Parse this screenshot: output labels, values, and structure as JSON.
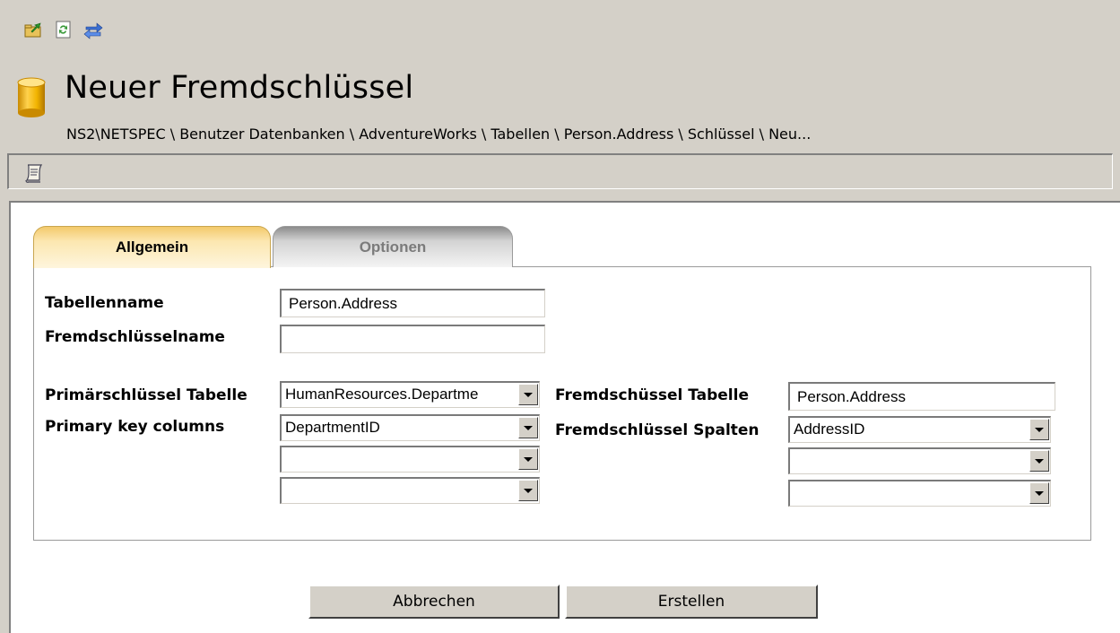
{
  "toolbar": {
    "icons": [
      "export-icon",
      "refresh-icon",
      "sync-icon"
    ]
  },
  "header": {
    "title": "Neuer Fremdschlüssel",
    "breadcrumb": "NS2\\NETSPEC \\ Benutzer Datenbanken \\ AdventureWorks \\ Tabellen \\ Person.Address \\ Schlüssel \\ Neu..."
  },
  "tabs": [
    {
      "label": "Allgemein",
      "active": true
    },
    {
      "label": "Optionen",
      "active": false
    }
  ],
  "form": {
    "table_name_label": "Tabellenname",
    "table_name_value": "Person.Address",
    "fk_name_label": "Fremdschlüsselname",
    "fk_name_value": "",
    "pk_table_label": "Primärschlüssel Tabelle",
    "pk_table_value": "HumanResources.Departme",
    "pk_columns_label": "Primary key columns",
    "pk_columns": [
      "DepartmentID",
      "",
      ""
    ],
    "fk_table_label": "Fremdschüssel Tabelle",
    "fk_table_value": "Person.Address",
    "fk_columns_label": "Fremdschlüssel Spalten",
    "fk_columns": [
      "AddressID",
      "",
      ""
    ]
  },
  "buttons": {
    "cancel": "Abbrechen",
    "create": "Erstellen"
  },
  "colors": {
    "window_bg": "#d4d0c8",
    "active_tab": "#f3c96b",
    "panel": "#ffffff"
  }
}
